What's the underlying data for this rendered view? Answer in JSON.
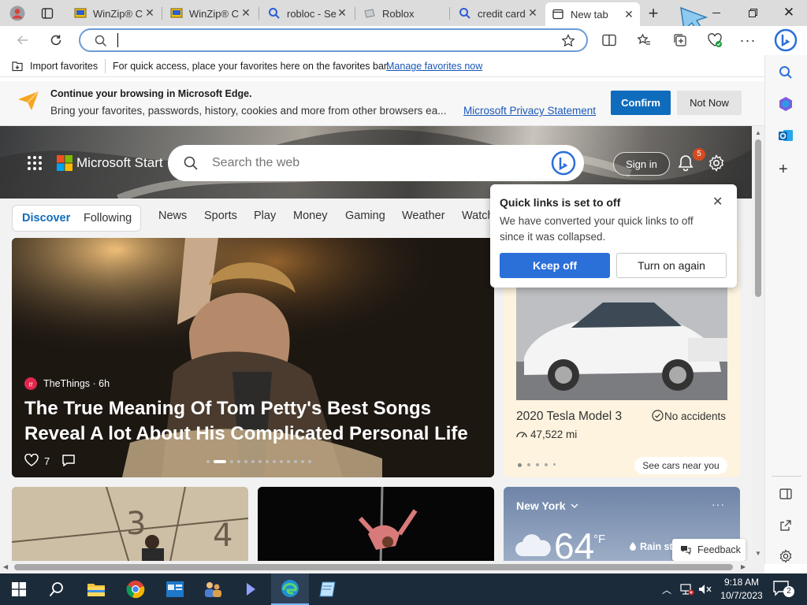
{
  "tabs": [
    {
      "title": "WinZip® C"
    },
    {
      "title": "WinZip® C"
    },
    {
      "title": "robloc - Se"
    },
    {
      "title": "Roblox"
    },
    {
      "title": "credit card"
    },
    {
      "title": "New tab"
    }
  ],
  "address": {
    "value": "",
    "placeholder": ""
  },
  "favorites_bar": {
    "import_label": "Import favorites",
    "hint": "For quick access, place your favorites here on the favorites bar.",
    "manage_link": "Manage favorites now"
  },
  "banner": {
    "title": "Continue your browsing in Microsoft Edge.",
    "body": "Bring your favorites, passwords, history, cookies and more from other browsers ea...",
    "link": "Microsoft Privacy Statement",
    "confirm": "Confirm",
    "not_now": "Not Now"
  },
  "msn": {
    "brand": "Microsoft Start",
    "search_placeholder": "Search the web",
    "sign_in": "Sign in",
    "notification_count": "5",
    "nav": {
      "discover": "Discover",
      "following": "Following",
      "items": [
        "News",
        "Sports",
        "Play",
        "Money",
        "Gaming",
        "Weather",
        "Watch"
      ]
    }
  },
  "popup": {
    "title": "Quick links is set to off",
    "body": "We have converted your quick links to off since it was collapsed.",
    "keep_off": "Keep off",
    "turn_on": "Turn on again"
  },
  "hero_story": {
    "source": "TheThings · 6h",
    "headline": "The True Meaning Of Tom Petty's Best Songs Reveal A lot About His Complicated Personal Life",
    "likes": "7"
  },
  "car_card": {
    "title": "2020 Tesla Model 3",
    "badge": "No accidents",
    "mileage": "47,522 mi",
    "cta": "See cars near you"
  },
  "weather": {
    "city": "New York",
    "temp": "64",
    "unit": "°F",
    "rain": "Rain sta"
  },
  "feedback": "Feedback",
  "taskbar": {
    "time": "9:18 AM",
    "date": "10/7/2023",
    "notifications": "2"
  },
  "colors": {
    "accent": "#0f6cbd",
    "popup_primary": "#2b6fd9",
    "link": "#1a57b8",
    "taskbar": "#1c2b3a",
    "car_card_bg": "#fdf3df"
  }
}
